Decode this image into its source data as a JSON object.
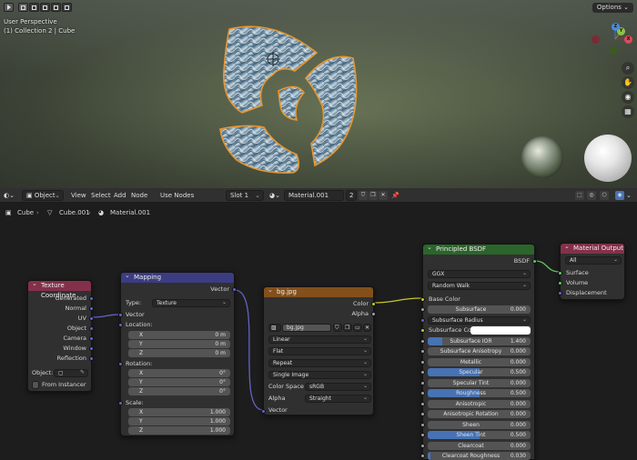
{
  "viewport": {
    "perspective_label": "User Perspective",
    "collection_label": "(1) Collection 2 | Cube",
    "options_label": "Options",
    "gizmo": {
      "x": "X",
      "y": "Y",
      "z": "Z"
    },
    "tools": [
      "zoom-icon",
      "hand-icon",
      "camera-icon",
      "grid-icon"
    ]
  },
  "node_header": {
    "object_mode": "Object",
    "menu": [
      "View",
      "Select",
      "Add",
      "Node"
    ],
    "use_nodes_label": "Use Nodes",
    "use_nodes_checked": "✓",
    "slot": "Slot 1",
    "material_name": "Material.001",
    "user_count": "2"
  },
  "breadcrumb": {
    "items": [
      "Cube",
      "Cube.001",
      "Material.001"
    ]
  },
  "nodes": {
    "texcoord": {
      "title": "Texture Coordinate",
      "outputs": [
        "Generated",
        "Normal",
        "UV",
        "Object",
        "Camera",
        "Window",
        "Reflection"
      ],
      "object_label": "Object:",
      "from_instancer": "From Instancer"
    },
    "mapping": {
      "title": "Mapping",
      "output": "Vector",
      "type_label": "Type:",
      "type_value": "Texture",
      "vector_input": "Vector",
      "location_label": "Location:",
      "location": [
        {
          "axis": "X",
          "value": "0 m"
        },
        {
          "axis": "Y",
          "value": "0 m"
        },
        {
          "axis": "Z",
          "value": "0 m"
        }
      ],
      "rotation_label": "Rotation:",
      "rotation": [
        {
          "axis": "X",
          "value": "0°"
        },
        {
          "axis": "Y",
          "value": "0°"
        },
        {
          "axis": "Z",
          "value": "0°"
        }
      ],
      "scale_label": "Scale:",
      "scale": [
        {
          "axis": "X",
          "value": "1.000"
        },
        {
          "axis": "Y",
          "value": "1.000"
        },
        {
          "axis": "Z",
          "value": "1.000"
        }
      ]
    },
    "image": {
      "title": "bg.jpg",
      "output_color": "Color",
      "output_alpha": "Alpha",
      "image_name": "bg.jpg",
      "interpolation": "Linear",
      "projection": "Flat",
      "extension": "Repeat",
      "source": "Single Image",
      "color_space_label": "Color Space",
      "color_space": "sRGB",
      "alpha_label": "Alpha",
      "alpha_mode": "Straight",
      "vector_input": "Vector"
    },
    "bsdf": {
      "title": "Principled BSDF",
      "output": "BSDF",
      "distribution": "GGX",
      "subsurface_method": "Random Walk",
      "base_color": "Base Color",
      "rows": [
        {
          "label": "Subsurface",
          "value": "0.000",
          "fill": 0
        },
        {
          "label": "Subsurface Radius",
          "value": "",
          "fill": 0,
          "dropdown": true
        },
        {
          "label": "Subsurface Col...",
          "value": "",
          "fill": 0,
          "color": "#ffffff"
        },
        {
          "label": "Subsurface IOR",
          "value": "1.400",
          "fill": 0.14
        },
        {
          "label": "Subsurface Anisotropy",
          "value": "0.000",
          "fill": 0
        },
        {
          "label": "Metallic",
          "value": "0.000",
          "fill": 0
        },
        {
          "label": "Specular",
          "value": "0.500",
          "fill": 0.5
        },
        {
          "label": "Specular Tint",
          "value": "0.000",
          "fill": 0
        },
        {
          "label": "Roughness",
          "value": "0.500",
          "fill": 0.5
        },
        {
          "label": "Anisotropic",
          "value": "0.000",
          "fill": 0
        },
        {
          "label": "Anisotropic Rotation",
          "value": "0.000",
          "fill": 0
        },
        {
          "label": "Sheen",
          "value": "0.000",
          "fill": 0
        },
        {
          "label": "Sheen Tint",
          "value": "0.500",
          "fill": 0.5
        },
        {
          "label": "Clearcoat",
          "value": "0.000",
          "fill": 0
        },
        {
          "label": "Clearcoat Roughness",
          "value": "0.030",
          "fill": 0.03
        }
      ]
    },
    "output": {
      "title": "Material Output",
      "target": "All",
      "inputs": [
        "Surface",
        "Volume",
        "Displacement"
      ]
    }
  },
  "colors": {
    "texcoord_header": "#83314a",
    "mapping_header": "#3c3c83",
    "image_header": "#83501c",
    "bsdf_header": "#2b652b",
    "output_header": "#83314a",
    "selection_outline": "#e8962f"
  }
}
